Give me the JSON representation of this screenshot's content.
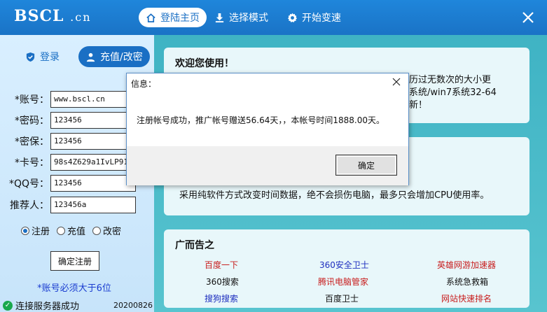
{
  "app": {
    "logo_main": "BSCL",
    "logo_domain": ".cn"
  },
  "nav": [
    {
      "label": "登陆主页",
      "icon": "home-icon",
      "active": true
    },
    {
      "label": "选择模式",
      "icon": "download-icon",
      "active": false
    },
    {
      "label": "开始变速",
      "icon": "gear-icon",
      "active": false
    }
  ],
  "left": {
    "tabs": [
      {
        "label": "登录",
        "icon": "shield-icon"
      },
      {
        "label": "充值/改密",
        "icon": "user-icon"
      }
    ],
    "fields": [
      {
        "label": "*账号：",
        "value": "www.bscl.cn"
      },
      {
        "label": "*密码：",
        "value": "123456"
      },
      {
        "label": "*密保：",
        "value": "123456"
      },
      {
        "label": "*卡号：",
        "value": "98s4Z629a1IvLP91"
      },
      {
        "label": "*QQ号：",
        "value": "123456"
      },
      {
        "label": "推荐人：",
        "value": "123456a"
      }
    ],
    "radios": [
      {
        "label": "注册",
        "checked": true
      },
      {
        "label": "充值",
        "checked": false
      },
      {
        "label": "改密",
        "checked": false
      }
    ],
    "register_button": "确定注册",
    "note": "*账号必须大于6位",
    "status": "连接服务器成功",
    "version": "20200826"
  },
  "cards": {
    "welcome_title": "欢迎您使用！",
    "welcome_lines": [
      "历过无数次的大小更",
      "系统/win7系统32-64",
      "新！"
    ],
    "info_line": "采用纯软件方式改变时间数据，绝不会损伤电脑，最多只会增加CPU使用率。",
    "ads_title": "广而告之",
    "ads": [
      {
        "label": "百度一下",
        "color": "#c81e1e"
      },
      {
        "label": "360安全卫士",
        "color": "#1e2fbf"
      },
      {
        "label": "英雄网游加速器",
        "color": "#c81e1e"
      },
      {
        "label": "360搜索",
        "color": "#111111"
      },
      {
        "label": "腾讯电脑管家",
        "color": "#c81e1e"
      },
      {
        "label": "系统急救箱",
        "color": "#111111"
      },
      {
        "label": "搜狗搜索",
        "color": "#1e2fbf"
      },
      {
        "label": "百度卫士",
        "color": "#111111"
      },
      {
        "label": "网站快速排名",
        "color": "#c81e1e"
      }
    ]
  },
  "dialog": {
    "title": "信息：",
    "message": "注册帐号成功，推广帐号赠送56.64天，，本帐号时间1888.00天。",
    "ok_label": "确定"
  }
}
